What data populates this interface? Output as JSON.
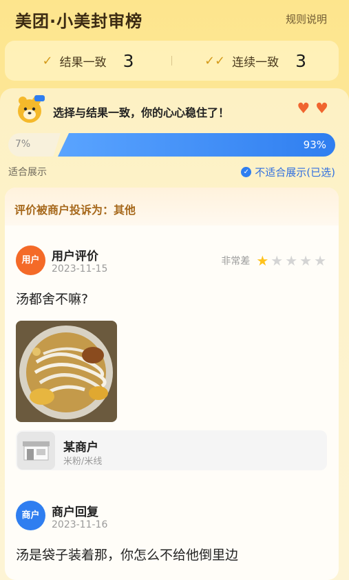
{
  "header": {
    "title": "美团·小美封审榜",
    "rules_link": "规则说明"
  },
  "stats": [
    {
      "icon": "check-icon",
      "label": "结果一致",
      "value": "3"
    },
    {
      "icon": "double-check-icon",
      "label": "连续一致",
      "value": "3"
    }
  ],
  "banner": {
    "mascot": "kangaroo-mascot-icon",
    "text": "选择与结果一致，你的心心稳住了！",
    "hearts": 2,
    "heart_color": "#f0652f"
  },
  "vote": {
    "left_percent": "7%",
    "right_percent": "93%",
    "left_option": "适合展示",
    "right_option": "不适合展示(已选)",
    "accent": "#2f7ef0"
  },
  "review": {
    "complaint": "评价被商户投诉为：其他",
    "avatar_label": "用户",
    "author": "用户评价",
    "date": "2023-11-15",
    "rating_label": "非常差",
    "rating": 1,
    "rating_max": 5,
    "text": "汤都舍不嘛?",
    "photo": "noodle-dish-photo"
  },
  "shop": {
    "name": "某商户",
    "category": "米粉/米线",
    "icon": "storefront-icon"
  },
  "reply": {
    "avatar_label": "商户",
    "author": "商户回复",
    "date": "2023-11-16",
    "text": "汤是袋子装着那，你怎么不给他倒里边"
  }
}
